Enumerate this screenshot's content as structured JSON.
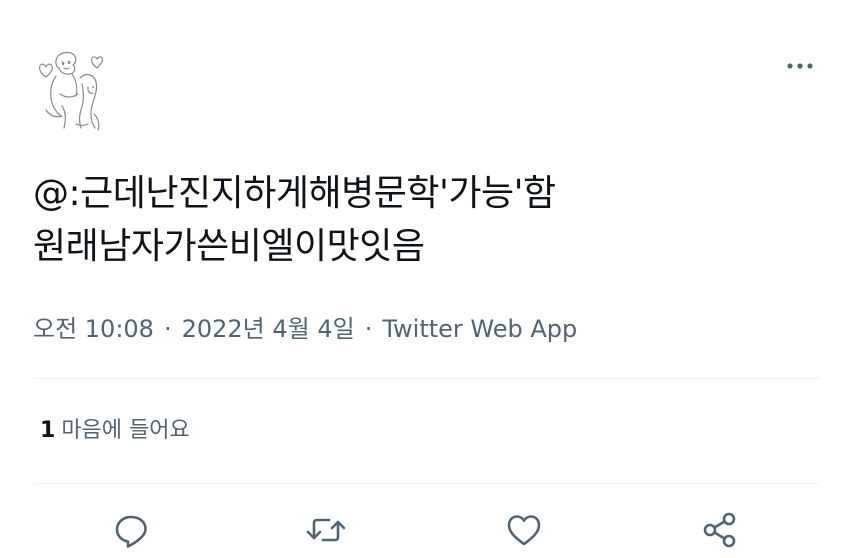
{
  "tweet": {
    "text_lines": [
      "@:근데난진지하게해병문학'가능'함",
      "원래남자가쓴비엘이맛잇음"
    ],
    "time": "오전 10:08",
    "separator": "·",
    "date": "2022년 4월 4일",
    "source": "Twitter Web App"
  },
  "engagement": {
    "like_count": "1",
    "like_label": "마음에 들어요"
  },
  "icons": {
    "more": "more-horizontal-icon",
    "reply": "reply-icon",
    "retweet": "retweet-icon",
    "like": "heart-icon",
    "share": "share-icon"
  },
  "colors": {
    "text": "#0f1419",
    "secondary": "#536471",
    "divider": "#eff3f4"
  }
}
